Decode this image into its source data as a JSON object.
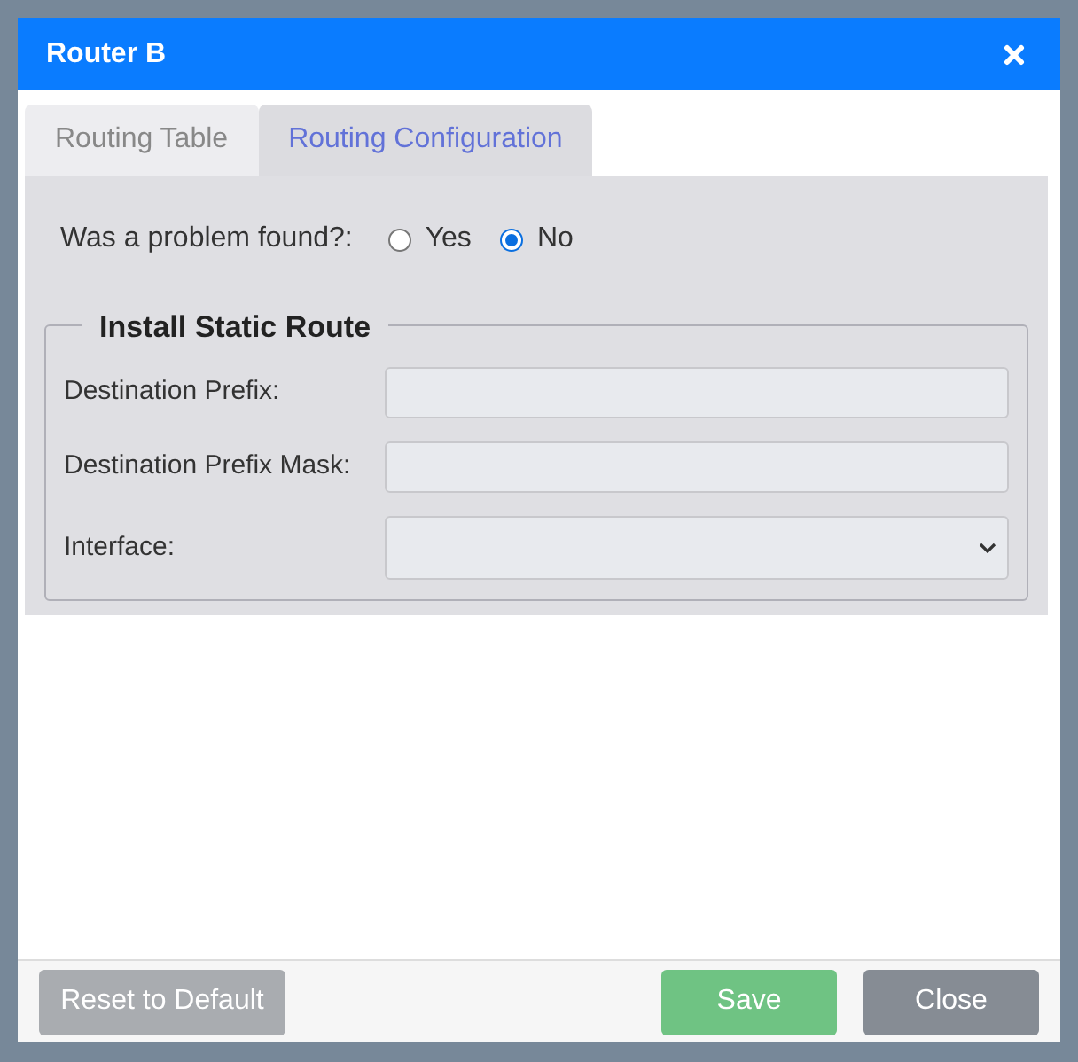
{
  "window": {
    "title": "Router B"
  },
  "tabs": [
    {
      "label": "Routing Table",
      "selected": false
    },
    {
      "label": "Routing Configuration",
      "selected": true
    }
  ],
  "question": {
    "label": "Was a problem found?:",
    "options": [
      {
        "label": "Yes",
        "selected": false
      },
      {
        "label": "No",
        "selected": true
      }
    ]
  },
  "static_route": {
    "legend": "Install Static Route",
    "fields": [
      {
        "label": "Destination Prefix:",
        "kind": "text"
      },
      {
        "label": "Destination Prefix Mask:",
        "kind": "text"
      },
      {
        "label": "Interface:",
        "kind": "select"
      }
    ]
  },
  "buttons": [
    {
      "label": "Reset to Default",
      "kind": "reset"
    },
    {
      "label": "Save",
      "kind": "save"
    },
    {
      "label": "Close",
      "kind": "close"
    }
  ]
}
